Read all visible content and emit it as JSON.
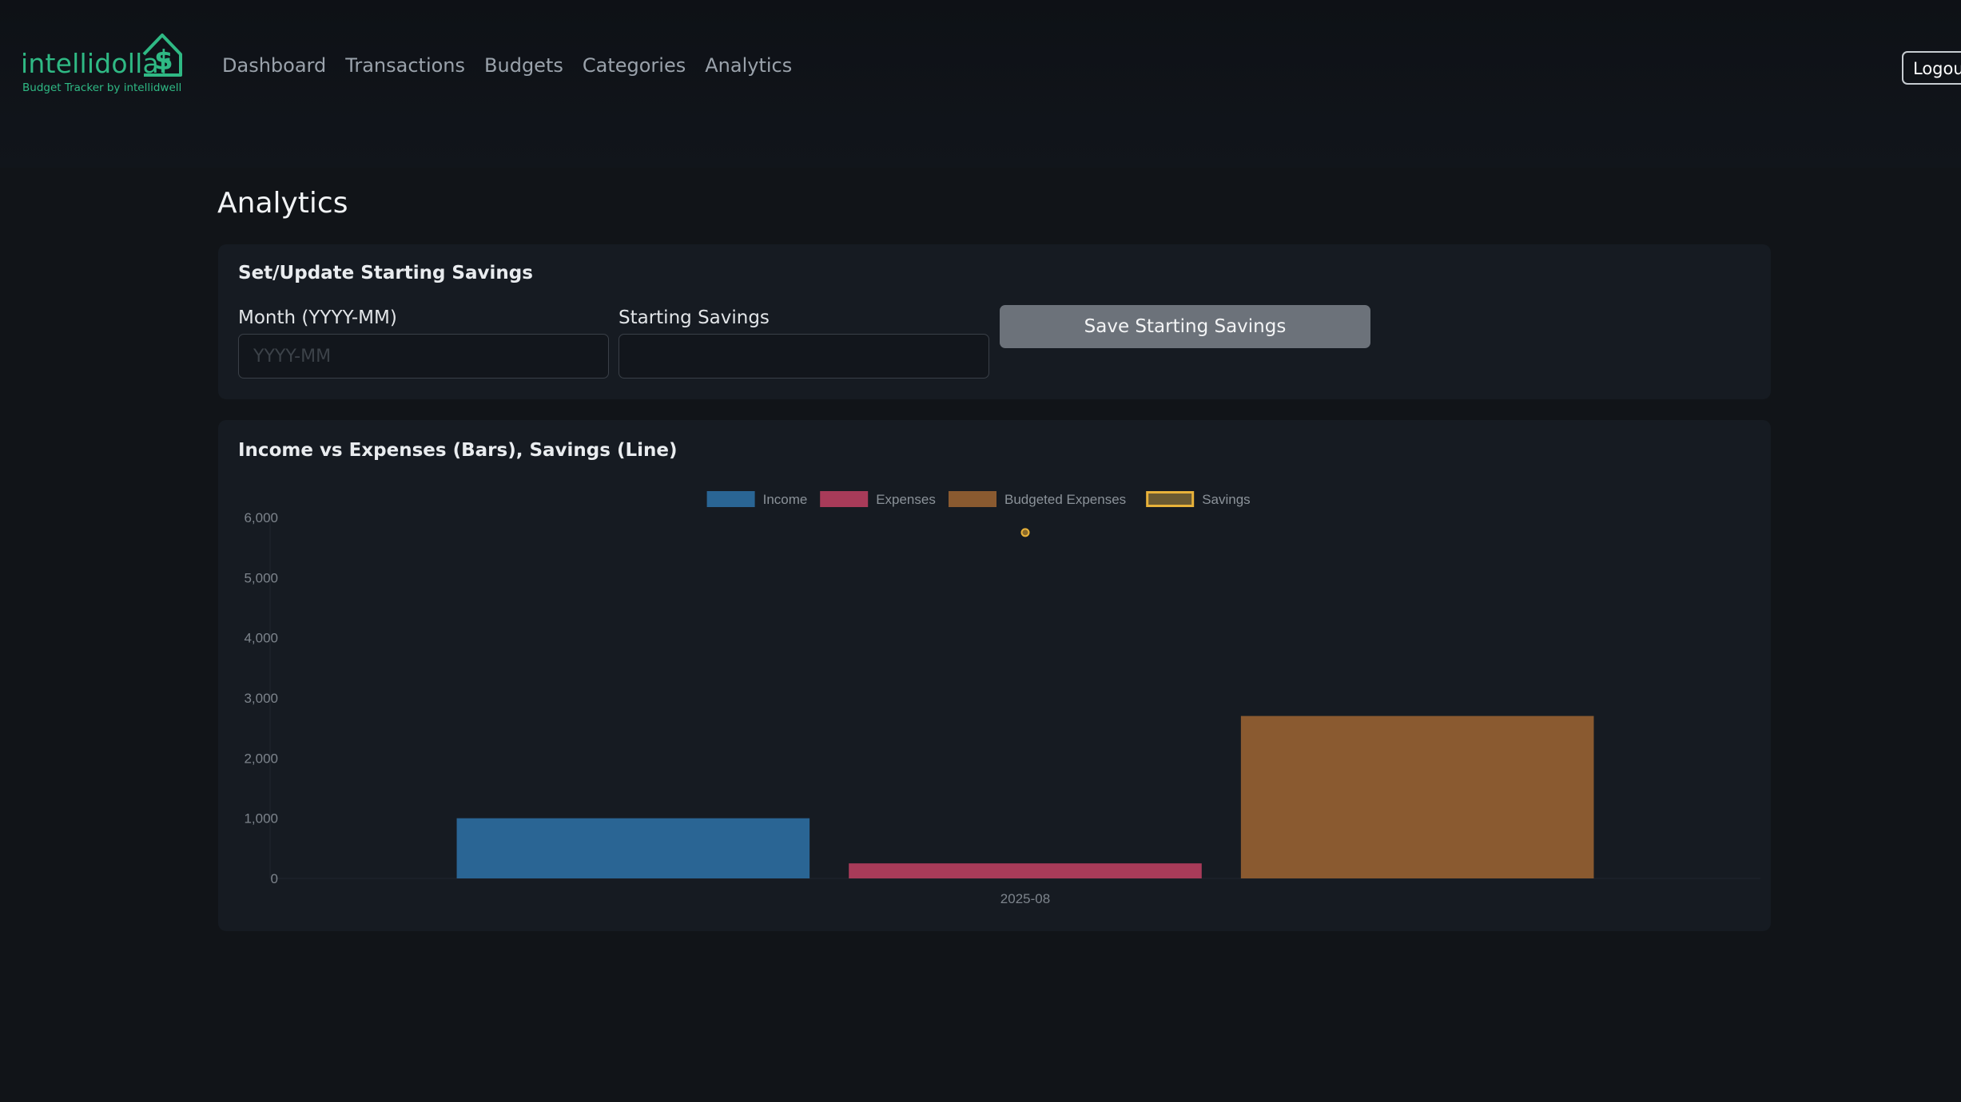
{
  "app": {
    "brand_name": "intellidollar",
    "brand_tagline": "Budget Tracker by intellidwell",
    "brand_color": "#2fb984"
  },
  "nav": {
    "links": [
      "Dashboard",
      "Transactions",
      "Budgets",
      "Categories",
      "Analytics"
    ],
    "logout_label": "Logout"
  },
  "page": {
    "title": "Analytics"
  },
  "savings_form": {
    "title": "Set/Update Starting Savings",
    "month_label": "Month (YYYY-MM)",
    "month_placeholder": "YYYY-MM",
    "month_value": "",
    "savings_label": "Starting Savings",
    "savings_value": "",
    "save_label": "Save Starting Savings"
  },
  "chart_card": {
    "title": "Income vs Expenses (Bars), Savings (Line)"
  },
  "chart_data": {
    "type": "bar",
    "title": "Income vs Expenses (Bars), Savings (Line)",
    "categories": [
      "2025-08"
    ],
    "ylim": [
      0,
      6000
    ],
    "y_ticks": [
      "0",
      "1,000",
      "2,000",
      "3,000",
      "4,000",
      "5,000",
      "6,000"
    ],
    "grid": false,
    "legend_position": "top-center",
    "series": [
      {
        "name": "Income",
        "kind": "bar",
        "values": [
          1000
        ],
        "color": "#2a6594"
      },
      {
        "name": "Expenses",
        "kind": "bar",
        "values": [
          250
        ],
        "color": "#a83b59"
      },
      {
        "name": "Budgeted Expenses",
        "kind": "bar",
        "values": [
          2700
        ],
        "color": "#8a5a30"
      },
      {
        "name": "Savings",
        "kind": "line",
        "values": [
          5750
        ],
        "color": "#e8b23a"
      }
    ]
  }
}
